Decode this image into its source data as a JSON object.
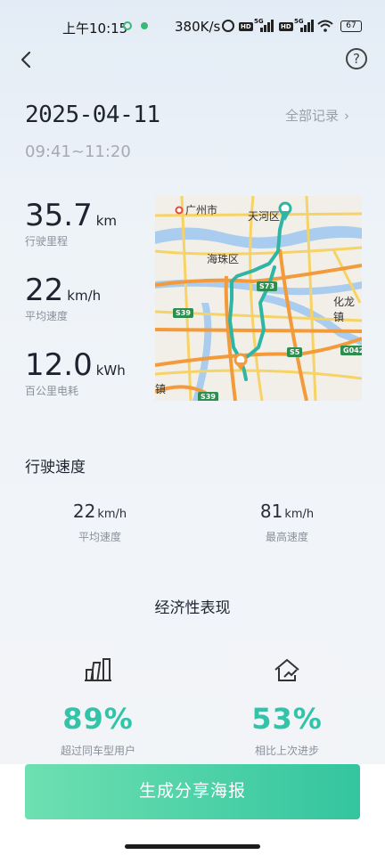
{
  "status_bar": {
    "time": "上午10:15",
    "net_speed": "380K/s",
    "battery": "67"
  },
  "header": {
    "date": "2025-04-11",
    "time_range": "09:41~11:20",
    "all_records_label": "全部记录",
    "help_label": "?"
  },
  "stats": [
    {
      "value": "35.7",
      "unit": "km",
      "label": "行驶里程"
    },
    {
      "value": "22",
      "unit": "km/h",
      "label": "平均速度"
    },
    {
      "value": "12.0",
      "unit": "kWh",
      "label": "百公里电耗"
    }
  ],
  "map": {
    "labels": {
      "city": "广州市",
      "tianhe": "天河区",
      "haizhu": "海珠区",
      "hualong": "化龙镇",
      "zhen": "镇"
    },
    "shields": {
      "s73": "S73",
      "s39a": "S39",
      "s5": "S5",
      "g0423": "G042",
      "s39b": "S39"
    },
    "colors": {
      "route": "#2fb5a3",
      "highway": "#f39a3b",
      "major": "#f7d265",
      "water": "#aacdef"
    }
  },
  "driving_speed": {
    "title": "行驶速度",
    "avg": {
      "value": "22",
      "unit": "km/h",
      "label": "平均速度"
    },
    "max": {
      "value": "81",
      "unit": "km/h",
      "label": "最高速度"
    }
  },
  "economy": {
    "title": "经济性表现",
    "items": [
      {
        "icon": "bar-chart-icon",
        "percent": "89%",
        "label": "超过同车型用户"
      },
      {
        "icon": "growth-house-icon",
        "percent": "53%",
        "label": "相比上次进步"
      }
    ]
  },
  "actions": {
    "share_label": "生成分享海报"
  }
}
